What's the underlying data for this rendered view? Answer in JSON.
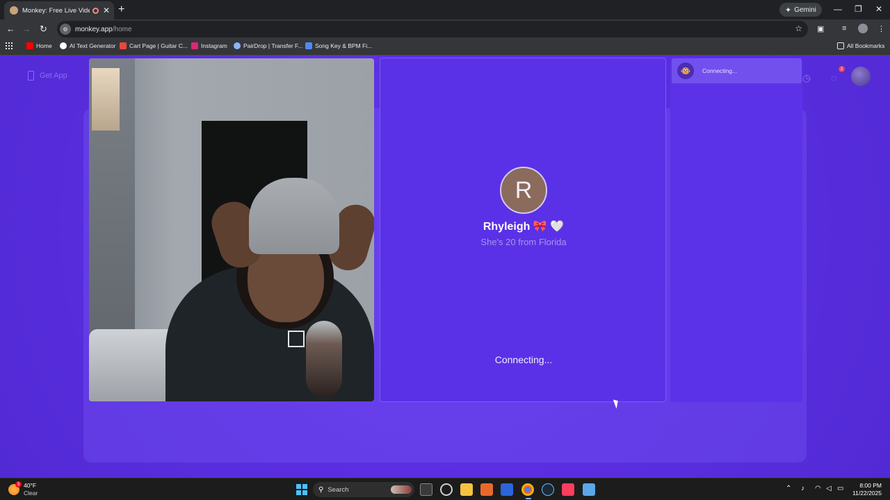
{
  "browser": {
    "tab_title": "Monkey: Free Live Video Ch",
    "tab_close": "✕",
    "new_tab": "+",
    "gemini_label": "Gemini",
    "window_min": "—",
    "window_max": "❐",
    "window_close": "✕",
    "url_host": "monkey.app",
    "url_path": "/home",
    "bookmarks": [
      {
        "label": "Home",
        "color": "#ff0000"
      },
      {
        "label": "AI Text Generator",
        "color": "#ffffff"
      },
      {
        "label": "Cart Page | Guitar C...",
        "color": "#e8483a"
      },
      {
        "label": "Instagram",
        "color": "#d62976"
      },
      {
        "label": "PairDrop | Transfer F...",
        "color": "#8ab4f8"
      },
      {
        "label": "Song Key & BPM Fi...",
        "color": "#4c8bf5"
      }
    ],
    "all_bookmarks": "All Bookmarks"
  },
  "app": {
    "get_app_label": "Get App",
    "chat_badge": "2",
    "partner": {
      "initial": "R",
      "name": "Rhyleigh",
      "emojis": "🎀 🤍",
      "subtitle": "She's 20 from Florida",
      "status": "Connecting..."
    },
    "chat_status": "Connecting...",
    "chat_icon": "🐵",
    "colors": {
      "background": "#5a2ee0",
      "panel": "#5a31e6",
      "accent": "#7250ee"
    }
  },
  "taskbar": {
    "weather_temp": "40°F",
    "weather_cond": "Clear",
    "weather_badge": "3",
    "search_placeholder": "Search",
    "time": "8:00 PM",
    "date": "11/22/2025"
  }
}
